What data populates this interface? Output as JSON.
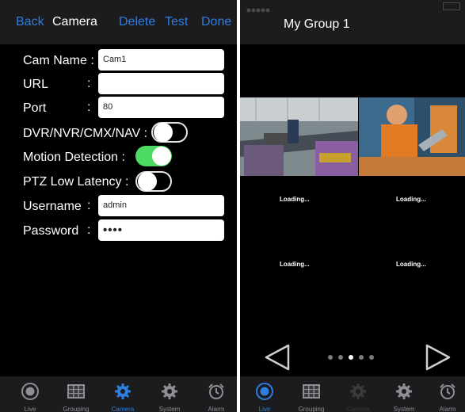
{
  "camera": {
    "nav": {
      "back": "Back",
      "title": "Camera",
      "delete": "Delete",
      "test": "Test",
      "done": "Done"
    },
    "fields": {
      "cam_name_label": "Cam Name :",
      "cam_name_value": "Cam1",
      "url_label": "URL",
      "url_value": "",
      "port_label": "Port",
      "port_value": "80",
      "dvr_label": "DVR/NVR/CMX/NAV :",
      "dvr_on": false,
      "motion_label": "Motion Detection  :",
      "motion_on": true,
      "ptz_label": "PTZ Low Latency  :",
      "ptz_on": false,
      "username_label": "Username",
      "username_value": "admin",
      "password_label": "Password",
      "password_value": "••••",
      "colon": ":"
    }
  },
  "group": {
    "title": "My Group 1",
    "loading_text": "Loading...",
    "page_count": 5,
    "active_page": 2
  },
  "tabs": [
    {
      "label": "Live",
      "icon": "live-icon"
    },
    {
      "label": "Grouping",
      "icon": "grouping-icon"
    },
    {
      "label": "Camera",
      "icon": "camera-settings-icon"
    },
    {
      "label": "System",
      "icon": "system-gear-icon"
    },
    {
      "label": "Alarm",
      "icon": "alarm-clock-icon"
    }
  ],
  "colors": {
    "accent": "#2e7de0",
    "switch_on": "#4cd964",
    "bar": "#1c1c1e"
  }
}
